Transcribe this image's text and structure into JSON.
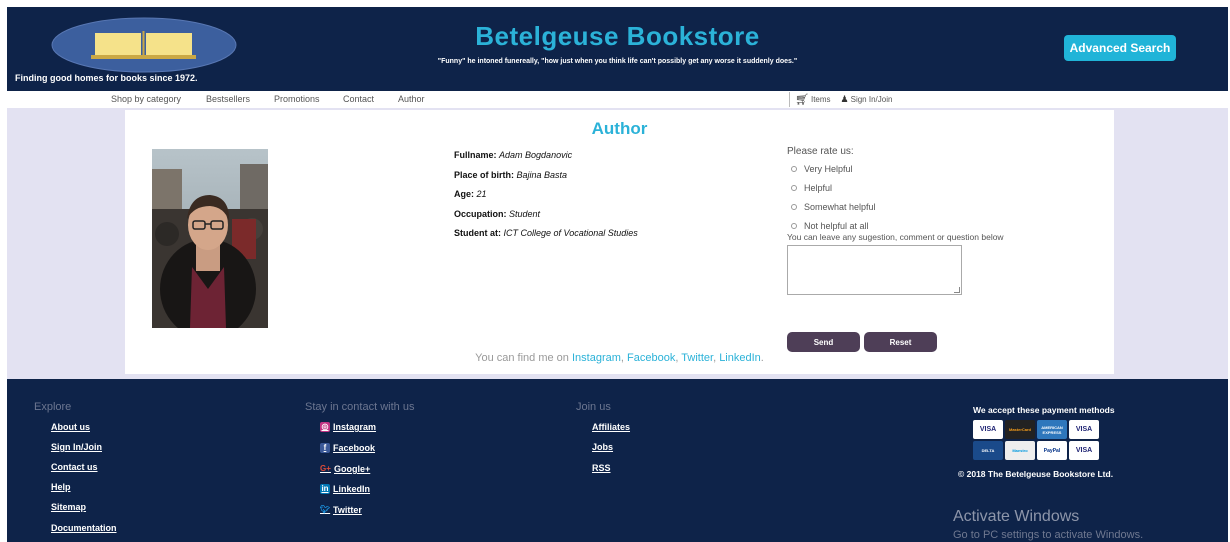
{
  "header": {
    "title": "Betelgeuse Bookstore",
    "tagline": "Finding good homes for books since 1972.",
    "quote": "\"Funny\" he intoned funereally, \"how just when you think life can't possibly get any worse it suddenly does.\"",
    "advanced_search": "Advanced Search",
    "logo_icon": "open-book-icon"
  },
  "nav": {
    "items": [
      "Shop by category",
      "Bestsellers",
      "Promotions",
      "Contact",
      "Author"
    ],
    "cart_label": "Items",
    "signin_label": "Sign In/Join"
  },
  "author": {
    "heading": "Author",
    "fields": [
      {
        "label": "Fullname:",
        "value": "Adam Bogdanovic"
      },
      {
        "label": "Place of birth:",
        "value": "Bajina Basta"
      },
      {
        "label": "Age:",
        "value": "21"
      },
      {
        "label": "Occupation:",
        "value": "Student"
      },
      {
        "label": "Student at:",
        "value": "ICT College of Vocational Studies"
      }
    ]
  },
  "rating": {
    "title": "Please rate us:",
    "options": [
      "Very Helpful",
      "Helpful",
      "Somewhat helpful",
      "Not helpful at all"
    ],
    "comment_hint": "You can leave any sugestion, comment or question below",
    "send": "Send",
    "reset": "Reset"
  },
  "findme": {
    "prefix": "You can find me on",
    "links": [
      "Instagram",
      "Facebook",
      "Twitter",
      "LinkedIn"
    ]
  },
  "footer": {
    "explore": {
      "title": "Explore",
      "links": [
        "About us",
        "Sign In/Join",
        "Contact us",
        "Help",
        "Sitemap",
        "Documentation"
      ]
    },
    "contact": {
      "title": "Stay in contact with us",
      "links": [
        "Instagram",
        "Facebook",
        "Google+",
        "LinkedIn",
        "Twitter"
      ]
    },
    "join": {
      "title": "Join us",
      "links": [
        "Affiliates",
        "Jobs",
        "RSS"
      ]
    },
    "payment_title": "We accept these payment methods",
    "cards": [
      "VISA",
      "MasterCard",
      "AMERICAN EXPRESS",
      "VISA",
      "DELTA",
      "Maestro",
      "PayPal",
      "VISA"
    ],
    "copyright": "© 2018 The Betelgeuse Bookstore Ltd.",
    "activate_title": "Activate Windows",
    "activate_sub": "Go to PC settings to activate Windows."
  }
}
